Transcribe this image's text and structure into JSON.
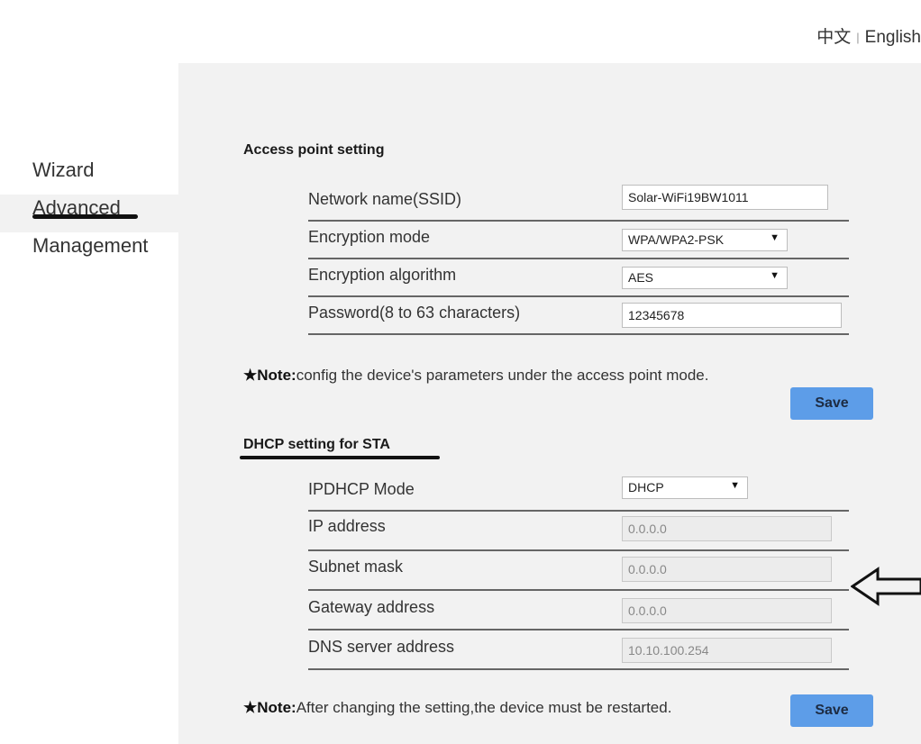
{
  "language": {
    "chinese": "中文",
    "separator": "|",
    "english": "English"
  },
  "nav": {
    "wizard": "Wizard",
    "advanced": "Advanced",
    "management": "Management"
  },
  "access_point": {
    "title": "Access point setting",
    "ssid_label": "Network name(SSID)",
    "ssid_value": "Solar-WiFi19BW1011",
    "encryption_mode_label": "Encryption mode",
    "encryption_mode_value": "WPA/WPA2-PSK",
    "encryption_algorithm_label": "Encryption algorithm",
    "encryption_algorithm_value": "AES",
    "password_label": "Password(8 to 63 characters)",
    "password_value": "12345678",
    "note_label": "★Note:",
    "note_text": "config the device's parameters under the access point mode.",
    "save_label": "Save"
  },
  "dhcp": {
    "title": "DHCP setting for STA",
    "mode_label": "IPDHCP Mode",
    "mode_value": "DHCP",
    "ip_label": "IP address",
    "ip_value": "0.0.0.0",
    "subnet_label": "Subnet mask",
    "subnet_value": "0.0.0.0",
    "gateway_label": "Gateway address",
    "gateway_value": "0.0.0.0",
    "dns_label": "DNS server address",
    "dns_value": "10.10.100.254",
    "note_label": "★Note:",
    "note_text": "After changing the setting,the device must be restarted.",
    "save_label": "Save"
  }
}
